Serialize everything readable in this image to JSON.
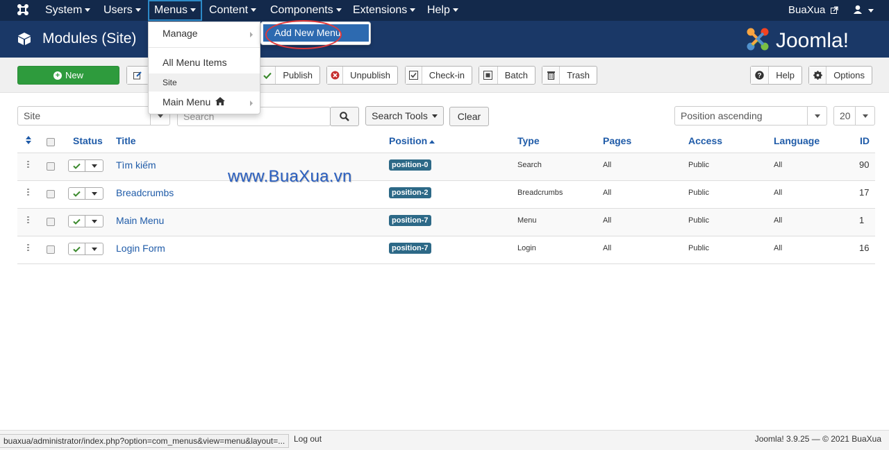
{
  "nav": {
    "system": "System",
    "users": "Users",
    "menus": "Menus",
    "content": "Content",
    "components": "Components",
    "extensions": "Extensions",
    "help": "Help",
    "username": "BuaXua"
  },
  "header": {
    "title": "Modules (Site)",
    "brand": "Joomla!"
  },
  "toolbar": {
    "new": "New",
    "publish": "Publish",
    "unpublish": "Unpublish",
    "checkin": "Check-in",
    "batch": "Batch",
    "trash": "Trash",
    "help": "Help",
    "options": "Options"
  },
  "menus_dropdown": {
    "manage": "Manage",
    "all_items": "All Menu Items",
    "site": "Site",
    "main_menu": "Main Menu",
    "submenu_add": "Add New Menu"
  },
  "filters": {
    "client": "Site",
    "search_placeholder": "Search",
    "search_tools": "Search Tools",
    "clear": "Clear",
    "ordering": "Position ascending",
    "limit": "20"
  },
  "table": {
    "headers": {
      "status": "Status",
      "title": "Title",
      "position": "Position",
      "type": "Type",
      "pages": "Pages",
      "access": "Access",
      "language": "Language",
      "id": "ID"
    },
    "rows": [
      {
        "title": "Tìm kiếm",
        "position": "position-0",
        "type": "Search",
        "pages": "All",
        "access": "Public",
        "language": "All",
        "id": "90"
      },
      {
        "title": "Breadcrumbs",
        "position": "position-2",
        "type": "Breadcrumbs",
        "pages": "All",
        "access": "Public",
        "language": "All",
        "id": "17"
      },
      {
        "title": "Main Menu",
        "position": "position-7",
        "type": "Menu",
        "pages": "All",
        "access": "Public",
        "language": "All",
        "id": "1"
      },
      {
        "title": "Login Form",
        "position": "position-7",
        "type": "Login",
        "pages": "All",
        "access": "Public",
        "language": "All",
        "id": "16"
      }
    ]
  },
  "watermark": "www.BuaXua.vn",
  "footer": {
    "status_url": "buaxua/administrator/index.php?option=com_menus&view=menu&layout=...",
    "logout": "Log out",
    "copyright": "Joomla! 3.9.25 — © 2021 BuaXua"
  },
  "colors": {
    "navbar": "#13294b",
    "header": "#1a3867",
    "new_button": "#2e9b3d",
    "link": "#1f5ba8",
    "badge": "#2d6987",
    "highlight": "#2d6ab0",
    "ring": "#e0393a"
  }
}
